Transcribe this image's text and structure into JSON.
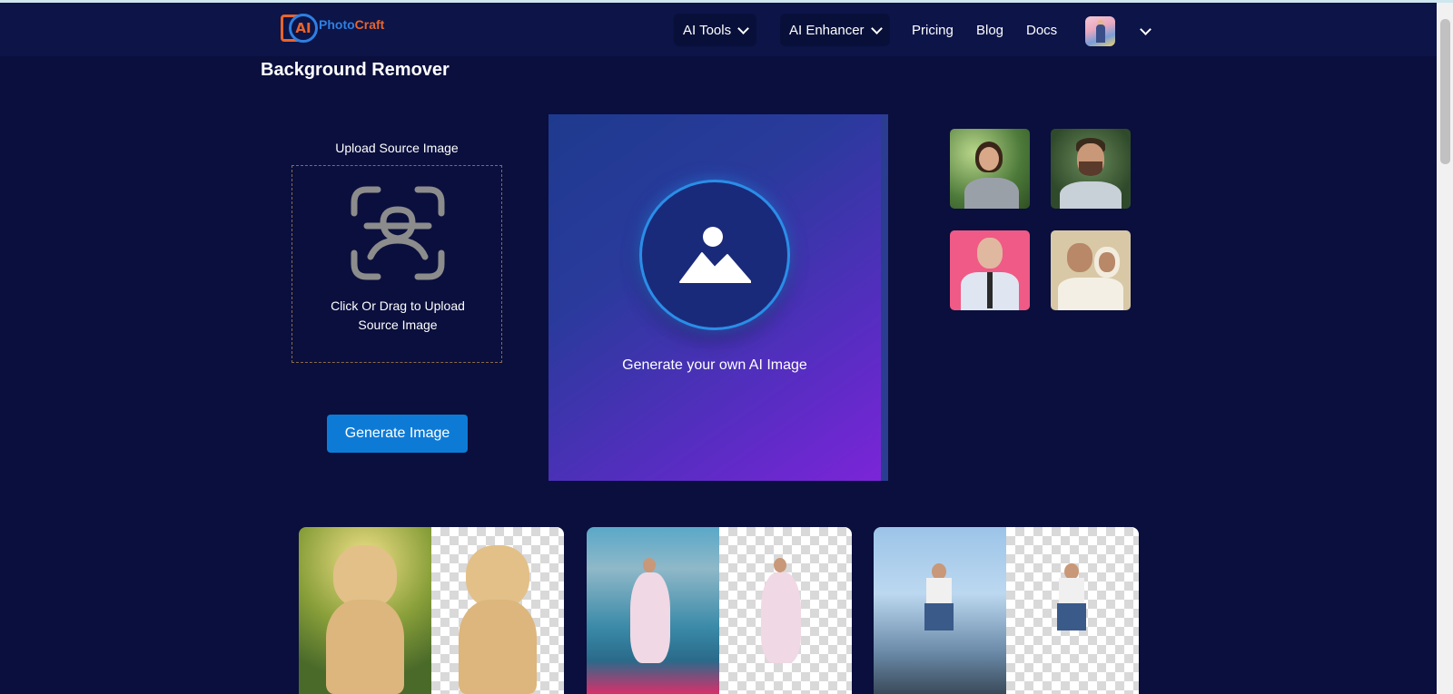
{
  "nav": {
    "logo_ai": "AI",
    "logo_part1": "Photo",
    "logo_part2": "Craft",
    "items": [
      {
        "label": "AI Tools"
      },
      {
        "label": "AI Enhancer"
      },
      {
        "label": "Pricing"
      },
      {
        "label": "Blog"
      },
      {
        "label": "Docs"
      }
    ]
  },
  "page": {
    "title": "Background Remover"
  },
  "upload": {
    "label": "Upload Source Image",
    "dropzone_line1": "Click Or Drag to Upload",
    "dropzone_line2": "Source Image",
    "button": "Generate Image"
  },
  "preview": {
    "text": "Generate your own AI Image"
  },
  "colors": {
    "background": "#0a0f3d",
    "navbar": "#0c1448",
    "button": "#0d7bd6",
    "logo_orange": "#e8642c",
    "logo_blue": "#2f7fe0"
  },
  "icons": [
    "face-scan-icon",
    "image-icon",
    "chevron-down-icon"
  ]
}
